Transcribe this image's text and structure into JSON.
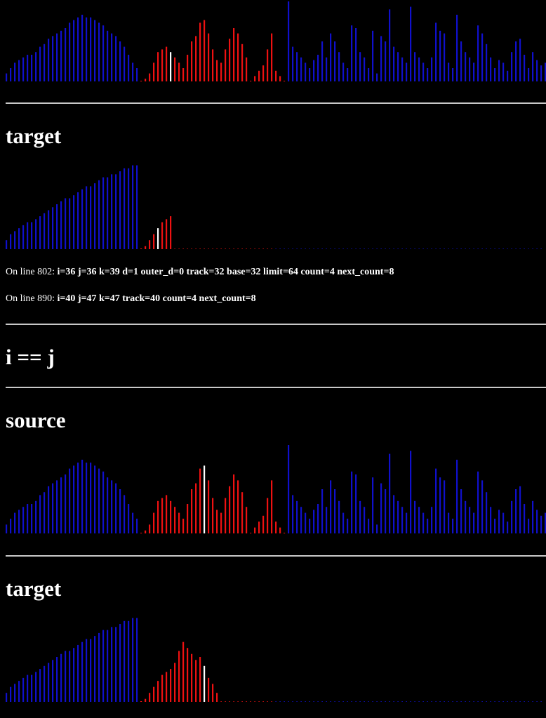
{
  "sections": {
    "target_1": "target",
    "condition": "i == j",
    "source_2": "source",
    "target_2": "target"
  },
  "status_lines": [
    {
      "prefix": "On line 802:",
      "vars": "i=36 j=36 k=39 d=1 outer_d=0 track=32 base=32 limit=64 count=4 next_count=8"
    },
    {
      "prefix": "On line 890:",
      "vars": "i=40 j=47 k=47 track=40 count=4 next_count=8"
    }
  ],
  "colors": {
    "background": "#000000",
    "sorted": "#1010cc",
    "merging": "#ee1111",
    "current": "#ffffff",
    "divider": "#c8c8c8"
  },
  "chart_data": [
    {
      "type": "bar",
      "name": "source",
      "ylim": [
        0,
        30
      ],
      "values": [
        3,
        5,
        7,
        8,
        9,
        10,
        10,
        11,
        13,
        14,
        16,
        17,
        18,
        19,
        20,
        22,
        23,
        24,
        25,
        24,
        24,
        23,
        22,
        21,
        19,
        18,
        17,
        15,
        13,
        10,
        7,
        5,
        0,
        1,
        3,
        7,
        11,
        12,
        13,
        11,
        9,
        7,
        5,
        10,
        15,
        17,
        22,
        23,
        18,
        12,
        8,
        7,
        12,
        16,
        20,
        18,
        14,
        9,
        0,
        2,
        4,
        6,
        12,
        18,
        4,
        2,
        0,
        30,
        13,
        11,
        9,
        7,
        5,
        8,
        10,
        15,
        9,
        18,
        15,
        11,
        7,
        5,
        21,
        20,
        11,
        9,
        5,
        19,
        3,
        17,
        15,
        27,
        13,
        11,
        9,
        7,
        28,
        11,
        9,
        7,
        5,
        9,
        22,
        19,
        18,
        7,
        5,
        25,
        15,
        11,
        9,
        7,
        21,
        18,
        14,
        9,
        5,
        8,
        7,
        4,
        11,
        15,
        16,
        10,
        5,
        11,
        8,
        6,
        7,
        9
      ],
      "colors": [
        "b",
        "b",
        "b",
        "b",
        "b",
        "b",
        "b",
        "b",
        "b",
        "b",
        "b",
        "b",
        "b",
        "b",
        "b",
        "b",
        "b",
        "b",
        "b",
        "b",
        "b",
        "b",
        "b",
        "b",
        "b",
        "b",
        "b",
        "b",
        "b",
        "b",
        "b",
        "b",
        "r",
        "r",
        "r",
        "r",
        "r",
        "r",
        "r",
        "w",
        "r",
        "r",
        "r",
        "r",
        "r",
        "r",
        "r",
        "r",
        "r",
        "r",
        "r",
        "r",
        "r",
        "r",
        "r",
        "r",
        "r",
        "r",
        "r",
        "r",
        "r",
        "r",
        "r",
        "r",
        "r",
        "r",
        "r",
        "b",
        "b",
        "b",
        "b",
        "b",
        "b",
        "b",
        "b",
        "b",
        "b",
        "b",
        "b",
        "b",
        "b",
        "b",
        "b",
        "b",
        "b",
        "b",
        "b",
        "b",
        "b",
        "b",
        "b",
        "b",
        "b",
        "b",
        "b",
        "b",
        "b",
        "b",
        "b",
        "b",
        "b",
        "b",
        "b",
        "b",
        "b",
        "b",
        "b",
        "b",
        "b",
        "b",
        "b",
        "b",
        "b",
        "b",
        "b",
        "b",
        "b",
        "b",
        "b",
        "b",
        "b",
        "b",
        "b",
        "b",
        "b",
        "b",
        "b",
        "b",
        "b",
        "b"
      ]
    },
    {
      "type": "bar",
      "name": "target",
      "ylim": [
        0,
        30
      ],
      "values": [
        3,
        5,
        6,
        7,
        8,
        9,
        9,
        10,
        11,
        12,
        13,
        14,
        15,
        16,
        17,
        17,
        18,
        19,
        20,
        21,
        21,
        22,
        23,
        24,
        24,
        25,
        25,
        26,
        27,
        27,
        28,
        28,
        0,
        1,
        3,
        5,
        7,
        9,
        10,
        11
      ],
      "colors": [
        "b",
        "b",
        "b",
        "b",
        "b",
        "b",
        "b",
        "b",
        "b",
        "b",
        "b",
        "b",
        "b",
        "b",
        "b",
        "b",
        "b",
        "b",
        "b",
        "b",
        "b",
        "b",
        "b",
        "b",
        "b",
        "b",
        "b",
        "b",
        "b",
        "b",
        "b",
        "b",
        "r",
        "r",
        "r",
        "r",
        "w",
        "r",
        "r",
        "r"
      ],
      "dots": {
        "red_until": 64,
        "total": 128
      }
    },
    {
      "type": "bar",
      "name": "source",
      "ylim": [
        0,
        30
      ],
      "values": [
        3,
        5,
        7,
        8,
        9,
        10,
        10,
        11,
        13,
        14,
        16,
        17,
        18,
        19,
        20,
        22,
        23,
        24,
        25,
        24,
        24,
        23,
        22,
        21,
        19,
        18,
        17,
        15,
        13,
        10,
        7,
        5,
        0,
        1,
        3,
        7,
        11,
        12,
        13,
        11,
        9,
        7,
        5,
        10,
        15,
        17,
        22,
        23,
        18,
        12,
        8,
        7,
        12,
        16,
        20,
        18,
        14,
        9,
        0,
        2,
        4,
        6,
        12,
        18,
        4,
        2,
        0,
        30,
        13,
        11,
        9,
        7,
        5,
        8,
        10,
        15,
        9,
        18,
        15,
        11,
        7,
        5,
        21,
        20,
        11,
        9,
        5,
        19,
        3,
        17,
        15,
        27,
        13,
        11,
        9,
        7,
        28,
        11,
        9,
        7,
        5,
        9,
        22,
        19,
        18,
        7,
        5,
        25,
        15,
        11,
        9,
        7,
        21,
        18,
        14,
        9,
        5,
        8,
        7,
        4,
        11,
        15,
        16,
        10,
        5,
        11,
        8,
        6,
        7,
        9
      ],
      "colors": [
        "b",
        "b",
        "b",
        "b",
        "b",
        "b",
        "b",
        "b",
        "b",
        "b",
        "b",
        "b",
        "b",
        "b",
        "b",
        "b",
        "b",
        "b",
        "b",
        "b",
        "b",
        "b",
        "b",
        "b",
        "b",
        "b",
        "b",
        "b",
        "b",
        "b",
        "b",
        "b",
        "r",
        "r",
        "r",
        "r",
        "r",
        "r",
        "r",
        "r",
        "r",
        "r",
        "r",
        "r",
        "r",
        "r",
        "r",
        "w",
        "r",
        "r",
        "r",
        "r",
        "r",
        "r",
        "r",
        "r",
        "r",
        "r",
        "r",
        "r",
        "r",
        "r",
        "r",
        "r",
        "r",
        "r",
        "r",
        "b",
        "b",
        "b",
        "b",
        "b",
        "b",
        "b",
        "b",
        "b",
        "b",
        "b",
        "b",
        "b",
        "b",
        "b",
        "b",
        "b",
        "b",
        "b",
        "b",
        "b",
        "b",
        "b",
        "b",
        "b",
        "b",
        "b",
        "b",
        "b",
        "b",
        "b",
        "b",
        "b",
        "b",
        "b",
        "b",
        "b",
        "b",
        "b",
        "b",
        "b",
        "b",
        "b",
        "b",
        "b",
        "b",
        "b",
        "b",
        "b",
        "b",
        "b",
        "b",
        "b",
        "b",
        "b",
        "b",
        "b",
        "b",
        "b",
        "b",
        "b",
        "b",
        "b"
      ]
    },
    {
      "type": "bar",
      "name": "target",
      "ylim": [
        0,
        30
      ],
      "values": [
        3,
        5,
        6,
        7,
        8,
        9,
        9,
        10,
        11,
        12,
        13,
        14,
        15,
        16,
        17,
        17,
        18,
        19,
        20,
        21,
        21,
        22,
        23,
        24,
        24,
        25,
        25,
        26,
        27,
        27,
        28,
        28,
        0,
        1,
        3,
        5,
        7,
        9,
        10,
        11,
        13,
        17,
        20,
        18,
        16,
        14,
        15,
        12,
        8,
        6,
        3
      ],
      "colors": [
        "b",
        "b",
        "b",
        "b",
        "b",
        "b",
        "b",
        "b",
        "b",
        "b",
        "b",
        "b",
        "b",
        "b",
        "b",
        "b",
        "b",
        "b",
        "b",
        "b",
        "b",
        "b",
        "b",
        "b",
        "b",
        "b",
        "b",
        "b",
        "b",
        "b",
        "b",
        "b",
        "r",
        "r",
        "r",
        "r",
        "r",
        "r",
        "r",
        "r",
        "r",
        "r",
        "r",
        "r",
        "r",
        "r",
        "r",
        "w",
        "r",
        "r",
        "r"
      ],
      "dots": {
        "red_until": 64,
        "total": 128
      }
    }
  ]
}
